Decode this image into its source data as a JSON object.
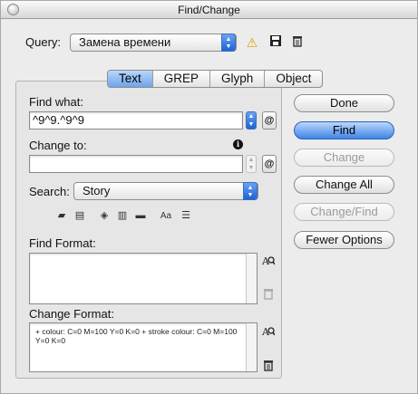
{
  "window": {
    "title": "Find/Change"
  },
  "query": {
    "label": "Query:",
    "selected": "Замена времени",
    "icons": [
      "warning-icon",
      "save-icon",
      "trash-icon"
    ]
  },
  "tabs": [
    {
      "label": "Text",
      "active": true
    },
    {
      "label": "GREP",
      "active": false
    },
    {
      "label": "Glyph",
      "active": false
    },
    {
      "label": "Object",
      "active": false
    }
  ],
  "find_what": {
    "label": "Find what:",
    "value": "^9^9.^9^9"
  },
  "change_to": {
    "label": "Change to:",
    "value": ""
  },
  "search": {
    "label": "Search:",
    "selected": "Story"
  },
  "option_icons": [
    "include-locked-layers-icon",
    "include-locked-stories-icon",
    "include-hidden-layers-icon",
    "include-master-pages-icon",
    "include-footnotes-icon",
    "case-sensitive-icon",
    "whole-word-icon"
  ],
  "find_format": {
    "label": "Find Format:",
    "value": ""
  },
  "change_format": {
    "label": "Change Format:",
    "value": "+ colour: C=0 M=100 Y=0 K=0 + stroke colour: C=0 M=100 Y=0 K=0"
  },
  "buttons": {
    "done": "Done",
    "find": "Find",
    "change": "Change",
    "change_all": "Change All",
    "change_find": "Change/Find",
    "fewer_options": "Fewer Options"
  },
  "special_char_glyph": "@",
  "info_glyph": "i",
  "colors": {
    "accent": "#3e84e6",
    "default_button": "#6aa3f0",
    "disabled_text": "#9a9a9a"
  }
}
